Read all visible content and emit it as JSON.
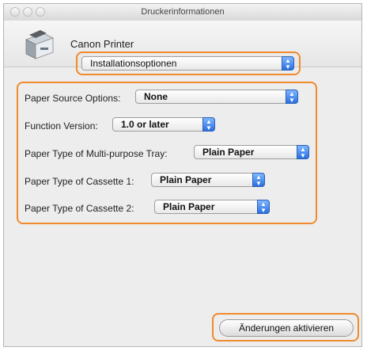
{
  "window": {
    "title": "Druckerinformationen"
  },
  "printer": {
    "name": "Canon Printer",
    "icon": "printer-icon"
  },
  "section_select": {
    "selected": "Installationsoptionen"
  },
  "options": [
    {
      "label": "Paper Source Options:",
      "value": "None"
    },
    {
      "label": "Function Version:",
      "value": "1.0 or later"
    },
    {
      "label": "Paper Type of Multi-purpose Tray:",
      "value": "Plain Paper"
    },
    {
      "label": "Paper Type of Cassette 1:",
      "value": "Plain Paper"
    },
    {
      "label": "Paper Type of Cassette 2:",
      "value": "Plain Paper"
    }
  ],
  "apply_button": {
    "label": "Änderungen aktivieren"
  },
  "colors": {
    "highlight": "#f08a2c",
    "popup_accent": "#2b6fe0",
    "window_bg": "#ededed"
  }
}
